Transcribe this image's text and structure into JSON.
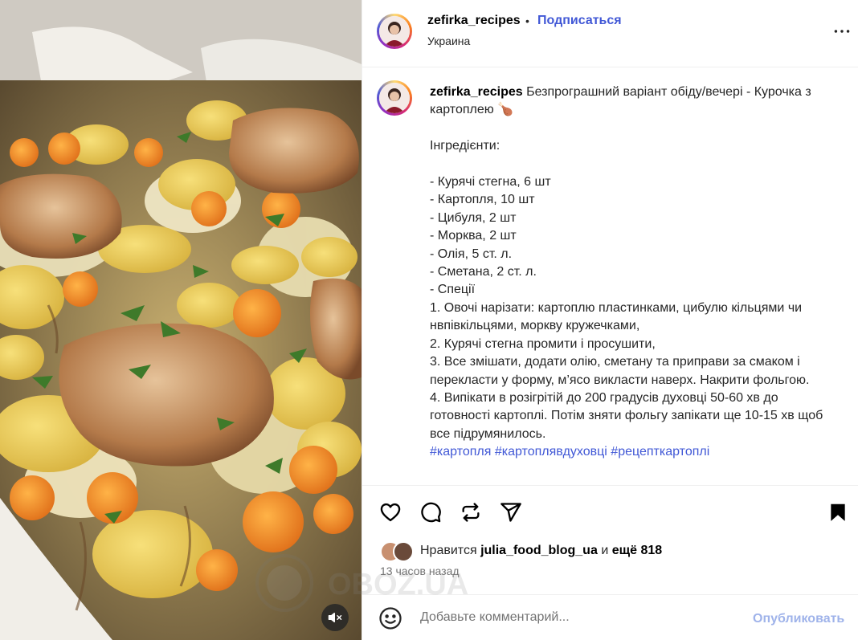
{
  "post": {
    "username": "zefirka_recipes",
    "separator": "•",
    "follow_label": "Подписаться",
    "location": "Украина",
    "more_icon": "more-horizontal-icon",
    "caption_username": "zefirka_recipes",
    "caption_text": " Безпрограшний варіант обіду/вечері - Курочка з картоплею 🍗\n\nІнгредієнти:\n\n- Курячі стегна, 6 шт\n- Картопля, 10 шт\n- Цибуля, 2 шт\n- Морква, 2 шт\n- Олія, 5 ст. л.\n- Сметана, 2 ст. л.\n- Спеції\n1. Овочі нарізати: картоплю пластинками, цибулю кільцями чи нвпівкільцями, моркву кружечками,\n2. Курячі стегна промити і просушити,\n3. Все змішати, додати олію, сметану та приправи за смаком і перекласти у форму, м’ясо викласти наверх. Накрити фольгою.\n4. Випікати в розігрітій до 200 градусів духовці 50-60 хв до готовності картоплі. Потім зняти фольгу запікати ще 10-15 хв щоб все підрумянилось.\n",
    "hashtags": "#картопля #картоплявдуховці #рецепткартоплі"
  },
  "actions": {
    "like_icon": "heart-icon",
    "comment_icon": "comment-icon",
    "repost_icon": "repost-icon",
    "share_icon": "send-icon",
    "save_icon": "bookmark-icon"
  },
  "likes": {
    "prefix": "Нравится",
    "user": "julia_food_blog_ua",
    "connector": "и",
    "others": "ещё 818"
  },
  "time_ago": "13 часов назад",
  "comment": {
    "emoji_icon": "emoji-icon",
    "placeholder": "Добавьте комментарий...",
    "publish_label": "Опубликовать"
  },
  "media": {
    "mute_icon": "volume-muted-icon"
  },
  "watermark": {
    "text": "OBOZ.UA"
  },
  "colors": {
    "link_blue": "#4158d6",
    "publish_disabled": "#9fb3ea",
    "muted_text": "#737373",
    "divider": "#efefef"
  }
}
